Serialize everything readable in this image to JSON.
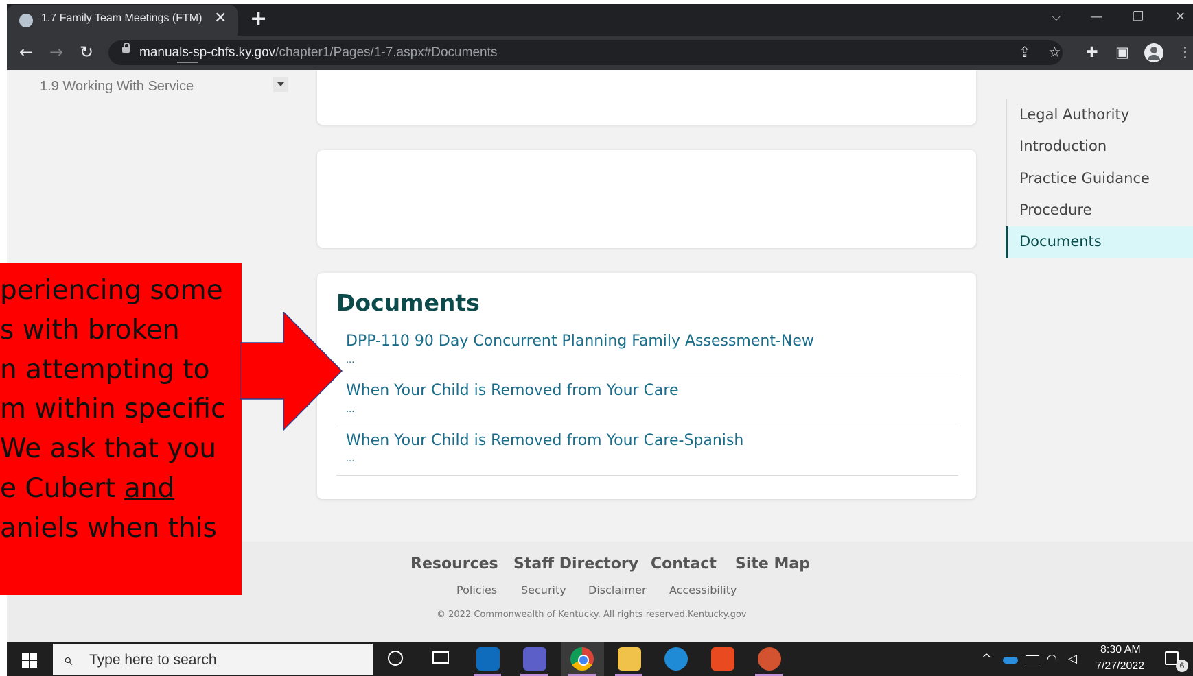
{
  "browser": {
    "tab_title": "1.7 Family Team Meetings (FTM)",
    "tab_close": "✕",
    "new_tab": "+",
    "url_host": "manuals-sp-chfs.ky.gov",
    "url_path": "/chapter1/Pages/1-7.aspx#Documents",
    "controls": {
      "dropdown": "⌵",
      "minimize": "—",
      "restore": "❐",
      "close": "✕"
    },
    "nav": {
      "back": "←",
      "forward": "→",
      "reload": "↻"
    },
    "toolbar_icons": {
      "share": "⇪",
      "bookmark": "☆",
      "extensions": "✚",
      "sidebar": "▣",
      "menu": "⋮"
    }
  },
  "left_nav": {
    "fragment": "1.9 Working With Service"
  },
  "documents": {
    "title": "Documents",
    "items": [
      {
        "label": "DPP-110 90 Day Concurrent Planning Family Assessment-New",
        "ellipsis": "..."
      },
      {
        "label": "When Your Child is Removed from Your Care",
        "ellipsis": "..."
      },
      {
        "label": "When Your Child is Removed from Your Care-Spanish",
        "ellipsis": "..."
      }
    ]
  },
  "toc": {
    "items": [
      "Legal Authority",
      "Introduction",
      "Practice Guidance",
      "Procedure",
      "Documents"
    ],
    "active": "Documents"
  },
  "footer": {
    "links": [
      "Resources",
      "Staff Directory",
      "Contact",
      "Site Map"
    ],
    "sublinks": [
      "Policies",
      "Security",
      "Disclaimer",
      "Accessibility"
    ],
    "copyright": "© 2022 Commonwealth of Kentucky. All rights reserved.Kentucky.gov"
  },
  "overlay": {
    "lines": [
      "periencing some",
      "s with broken",
      "n attempting to",
      "m within specific",
      "We ask that you"
    ],
    "line6_prefix": "e Cubert ",
    "line6_underlined": "and",
    "line7": "aniels when this",
    "box_color": "#ff0000",
    "arrow_color": "#ff0000"
  },
  "taskbar": {
    "search_placeholder": "Type here to search",
    "time": "8:30 AM",
    "date": "7/27/2022",
    "notifications": "6",
    "apps": [
      "cortana-icon",
      "task-view-icon",
      "outlook-icon",
      "teams-icon",
      "chrome-icon",
      "file-explorer-icon",
      "edge-icon",
      "office-icon",
      "powerpoint-icon"
    ]
  },
  "colors": {
    "heading": "#0b4b4b",
    "link": "#1a6d8a",
    "toc_active_bg": "#d9f7f9"
  }
}
